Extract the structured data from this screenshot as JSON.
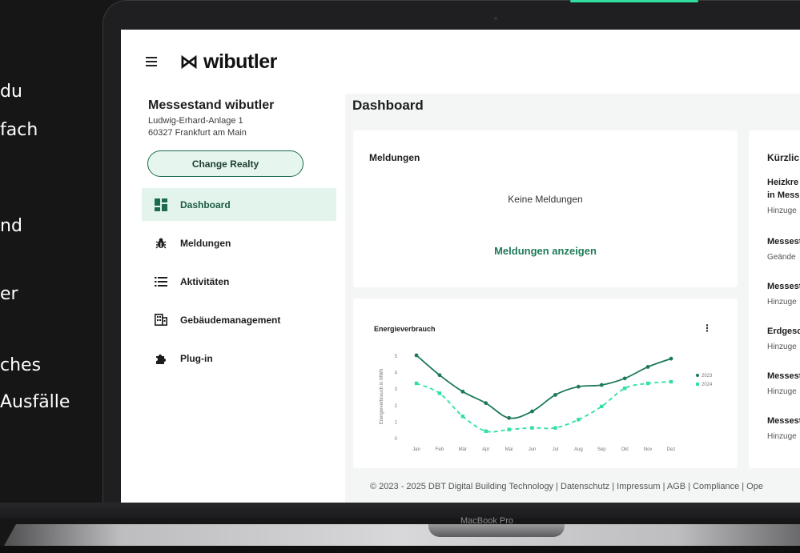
{
  "left_text": [
    "du",
    "fach",
    "nd",
    "er",
    "ches",
    "Ausfälle"
  ],
  "device_label": "MacBook Pro",
  "app": {
    "logo_text": "wibutler",
    "realty": {
      "name": "Messestand wibutler",
      "address_line1": "Ludwig-Erhard-Anlage 1",
      "address_line2": "60327 Frankfurt am Main"
    },
    "change_realty_label": "Change Realty",
    "nav": [
      {
        "label": "Dashboard",
        "icon": "dashboard-icon",
        "active": true
      },
      {
        "label": "Meldungen",
        "icon": "bug-icon",
        "active": false
      },
      {
        "label": "Aktivitäten",
        "icon": "list-icon",
        "active": false
      },
      {
        "label": "Gebäudemanagement",
        "icon": "building-icon",
        "active": false
      },
      {
        "label": "Plug-in",
        "icon": "puzzle-icon",
        "active": false
      }
    ],
    "page_title": "Dashboard",
    "messages_card": {
      "title": "Meldungen",
      "empty_text": "Keine Meldungen",
      "link_label": "Meldungen anzeigen"
    },
    "energy_card": {
      "title": "Energieverbrauch",
      "menu_icon": "kebab-menu-icon"
    },
    "recent_card": {
      "title": "Kürzlic",
      "items": [
        {
          "title": "Heizkre",
          "title2": "in Mess",
          "sub": "Hinzuge"
        },
        {
          "title": "Messest",
          "sub": "Geände"
        },
        {
          "title": "Messest",
          "sub": "Hinzuge"
        },
        {
          "title": "Erdgesc",
          "sub": "Hinzuge"
        },
        {
          "title": "Messest",
          "sub": "Hinzuge"
        },
        {
          "title": "Messest",
          "sub": "Hinzuge"
        }
      ]
    },
    "footer": "© 2023 - 2025 DBT Digital Building Technology | Datenschutz | Impressum | AGB | Compliance | Ope"
  },
  "colors": {
    "accent": "#1f7a58",
    "series_2023": "#1d7a5a",
    "series_2024": "#2ee0a8",
    "active_nav_bg": "#e3f4ec"
  },
  "chart_data": {
    "type": "line",
    "title": "Energieverbrauch",
    "xlabel": "",
    "ylabel": "Energieverbrauch in MWh",
    "categories": [
      "Jan",
      "Feb",
      "Mär",
      "Apr",
      "Mai",
      "Jun",
      "Jul",
      "Aug",
      "Sep",
      "Okt",
      "Nov",
      "Dez"
    ],
    "ylim": [
      0,
      5
    ],
    "yticks": [
      "0",
      "1",
      "2",
      "3",
      "4",
      "5"
    ],
    "series": [
      {
        "name": "2023",
        "style": "solid",
        "values": [
          5.0,
          3.8,
          2.8,
          2.1,
          1.2,
          1.6,
          2.6,
          3.1,
          3.2,
          3.6,
          4.3,
          4.8
        ]
      },
      {
        "name": "2024",
        "style": "dashed",
        "values": [
          3.3,
          2.7,
          1.3,
          0.4,
          0.5,
          0.6,
          0.6,
          1.1,
          1.9,
          3.0,
          3.3,
          3.4
        ]
      }
    ],
    "legend": "right"
  }
}
